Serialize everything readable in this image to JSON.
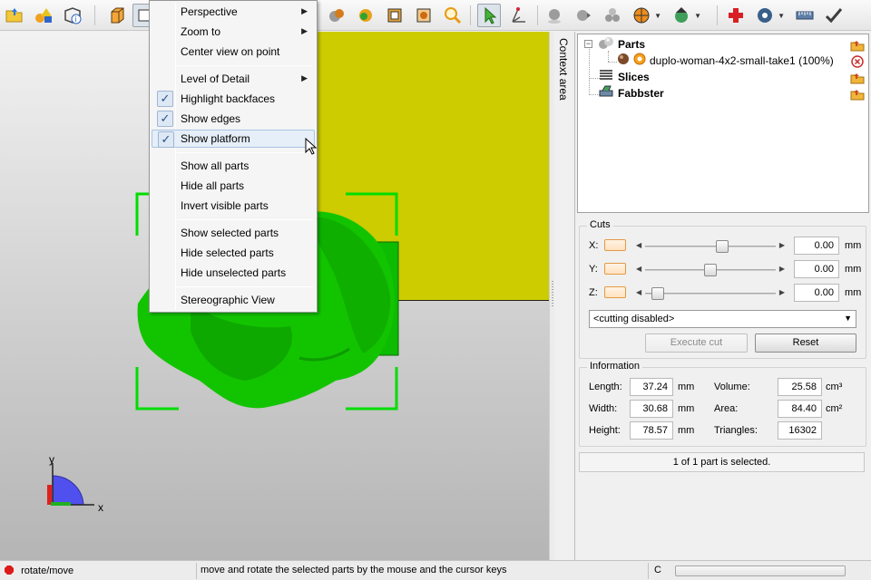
{
  "toolbar": {
    "icons": [
      "open-folder-icon",
      "add-shapes-icon",
      "part-info-icon",
      "view-cube-icon",
      "view-front-icon",
      "view-sphere-gray-icon",
      "view-sphere-color-icon",
      "wireframe-box-icon",
      "transparent-box-icon",
      "zoom-icon",
      "select-arrow-icon",
      "axis-transform-icon",
      "sphere-gray-icon",
      "sphere-move-icon",
      "sphere-group-icon",
      "pie-sphere-icon",
      "globe-arrow-icon",
      "add-red-cross-icon",
      "disc-icon",
      "ruler-icon",
      "checkmark-icon"
    ]
  },
  "menu": {
    "items": [
      {
        "label": "Perspective",
        "submenu": true
      },
      {
        "label": "Zoom to",
        "submenu": true
      },
      {
        "label": "Center view on point"
      },
      {
        "label": "Level of Detail",
        "submenu": true
      },
      {
        "label": "Highlight backfaces",
        "checked": true
      },
      {
        "label": "Show edges",
        "checked": true
      },
      {
        "label": "Show platform",
        "checked": true,
        "hovered": true
      },
      {
        "label": "Show all parts"
      },
      {
        "label": "Hide all parts"
      },
      {
        "label": "Invert visible parts"
      },
      {
        "label": "Show selected parts"
      },
      {
        "label": "Hide selected parts"
      },
      {
        "label": "Hide unselected parts"
      },
      {
        "label": "Stereographic View"
      }
    ],
    "submenu_arrow": "▶",
    "check_glyph": "✓"
  },
  "viewport": {
    "axis_x": "x",
    "axis_y": "y",
    "part_color": "#11cc00",
    "platform_color": "#cccc00"
  },
  "context_tab": {
    "label": "Context area"
  },
  "tree": {
    "collapse_glyph": "−",
    "nodes": [
      {
        "label": "Parts",
        "icon": "parts-spheres-icon"
      },
      {
        "label": "duplo-woman-4x2-small-take1 (100%)",
        "icon": "part-mesh-icon"
      },
      {
        "label": "Slices",
        "icon": "slices-icon"
      },
      {
        "label": "Fabbster",
        "icon": "printer-icon"
      }
    ]
  },
  "cuts": {
    "title": "Cuts",
    "axes": [
      {
        "label": "X:",
        "value": "0.00",
        "unit": "mm",
        "slider_fraction": 0.6
      },
      {
        "label": "Y:",
        "value": "0.00",
        "unit": "mm",
        "slider_fraction": 0.5
      },
      {
        "label": "Z:",
        "value": "0.00",
        "unit": "mm",
        "slider_fraction": 0.05
      }
    ],
    "mode": "<cutting disabled>",
    "execute_label": "Execute cut",
    "reset_label": "Reset"
  },
  "info": {
    "title": "Information",
    "length_label": "Length:",
    "length_value": "37.24",
    "length_unit": "mm",
    "width_label": "Width:",
    "width_value": "30.68",
    "width_unit": "mm",
    "height_label": "Height:",
    "height_value": "78.57",
    "height_unit": "mm",
    "volume_label": "Volume:",
    "volume_value": "25.58",
    "volume_unit": "cm³",
    "area_label": "Area:",
    "area_value": "84.40",
    "area_unit": "cm²",
    "triangles_label": "Triangles:",
    "triangles_value": "16302"
  },
  "selection_status": "1 of 1 part is selected.",
  "statusbar": {
    "mode": "rotate/move",
    "hint": "move and rotate the selected parts by the mouse and the cursor keys",
    "flag": "C"
  }
}
